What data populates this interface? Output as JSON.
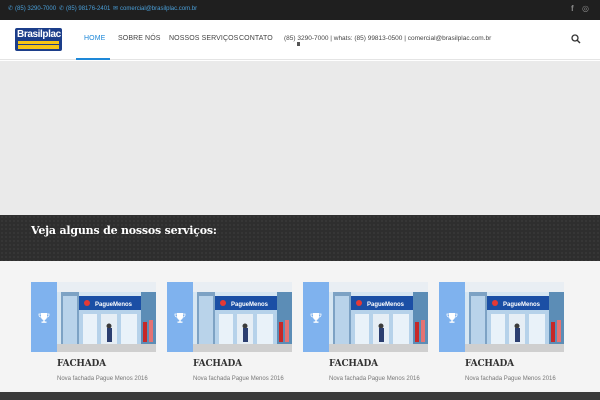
{
  "topbar": {
    "phone1": "(85) 3290-7000",
    "phone2": "(85) 98176-2401",
    "email": "comercial@brasilplac.com.br",
    "social": [
      "facebook-icon",
      "instagram-icon"
    ]
  },
  "logo": {
    "text": "Brasilplac",
    "tagline": "COMUNICAÇÃO VISUAL"
  },
  "nav": {
    "items": [
      "HOME",
      "SOBRE NÓS",
      "NOSSOS SERVIÇOS",
      "CONTATO"
    ],
    "active": "HOME",
    "info": "(85) 3290-7000 | whats: (85) 99813-0500 | comercial@brasilplac.com.br"
  },
  "services": {
    "title": "Veja alguns de nossos serviços:",
    "cards": [
      {
        "title": "FACHADA",
        "desc": "Nova fachada Pague Menos 2016",
        "store_sign": "PagueMenos"
      },
      {
        "title": "FACHADA",
        "desc": "Nova fachada Pague Menos 2016",
        "store_sign": "PagueMenos"
      },
      {
        "title": "FACHADA",
        "desc": "Nova fachada Pague Menos 2016",
        "store_sign": "PagueMenos"
      },
      {
        "title": "FACHADA",
        "desc": "Nova fachada Pague Menos 2016",
        "store_sign": "PagueMenos"
      }
    ]
  },
  "colors": {
    "accent": "#1e88d8",
    "card_side": "#7fb2ee",
    "topbar": "#1f1f1f",
    "banner": "#2e2e2e"
  }
}
